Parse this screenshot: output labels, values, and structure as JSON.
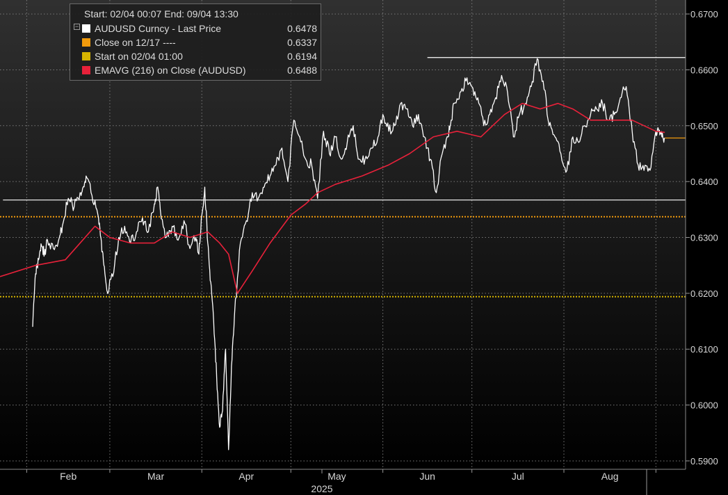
{
  "legend": {
    "header": "Start: 02/04 00:07 End: 09/04 13:30",
    "items": [
      {
        "label": "AUDUSD Curncy - Last Price",
        "value": "0.6478",
        "color": "#ffffff"
      },
      {
        "label": "Close on 12/17 ----",
        "value": "0.6337",
        "color": "#f29b0c"
      },
      {
        "label": "Start on 02/04 01:00",
        "value": "0.6194",
        "color": "#d6b400"
      },
      {
        "label": "EMAVG (216)  on Close (AUDUSD)",
        "value": "0.6488",
        "color": "#e8213a"
      }
    ]
  },
  "chart_data": {
    "type": "line",
    "xlabel": "2025",
    "x_ticks": [
      "Feb",
      "Mar",
      "Apr",
      "May",
      "Jun",
      "Jul",
      "Aug"
    ],
    "y_ticks": [
      "0.5900",
      "0.6000",
      "0.6100",
      "0.6200",
      "0.6300",
      "0.6400",
      "0.6500",
      "0.6600",
      "0.6700"
    ],
    "ylim": [
      0.5885,
      0.6725
    ],
    "grid": true,
    "legend_position": "top-left",
    "x_range": [
      "2025-01-23",
      "2025-09-11"
    ],
    "series": [
      {
        "name": "AUDUSD Curncy - Last Price",
        "color": "#ffffff",
        "x": [
          "2025-02-03",
          "2025-02-04",
          "2025-02-05",
          "2025-02-06",
          "2025-02-07",
          "2025-02-08",
          "2025-02-10",
          "2025-02-12",
          "2025-02-13",
          "2025-02-15",
          "2025-02-17",
          "2025-02-19",
          "2025-02-20",
          "2025-02-21",
          "2025-02-23",
          "2025-02-25",
          "2025-02-26",
          "2025-02-27",
          "2025-02-28",
          "2025-03-02",
          "2025-03-04",
          "2025-03-06",
          "2025-03-08",
          "2025-03-10",
          "2025-03-12",
          "2025-03-14",
          "2025-03-16",
          "2025-03-17",
          "2025-03-18",
          "2025-03-20",
          "2025-03-22",
          "2025-03-24",
          "2025-03-26",
          "2025-03-28",
          "2025-03-30",
          "2025-03-31",
          "2025-04-01",
          "2025-04-02",
          "2025-04-03",
          "2025-04-04",
          "2025-04-05",
          "2025-04-06",
          "2025-04-07",
          "2025-04-08",
          "2025-04-09",
          "2025-04-10",
          "2025-04-11",
          "2025-04-12",
          "2025-04-14",
          "2025-04-16",
          "2025-04-18",
          "2025-04-20",
          "2025-04-22",
          "2025-04-24",
          "2025-04-26",
          "2025-04-28",
          "2025-04-30",
          "2025-05-02",
          "2025-05-04",
          "2025-05-06",
          "2025-05-08",
          "2025-05-10",
          "2025-05-12",
          "2025-05-14",
          "2025-05-16",
          "2025-05-18",
          "2025-05-20",
          "2025-05-22",
          "2025-05-24",
          "2025-05-26",
          "2025-05-28",
          "2025-05-30",
          "2025-06-01",
          "2025-06-03",
          "2025-06-05",
          "2025-06-07",
          "2025-06-09",
          "2025-06-11",
          "2025-06-13",
          "2025-06-15",
          "2025-06-17",
          "2025-06-19",
          "2025-06-21",
          "2025-06-23",
          "2025-06-24",
          "2025-06-25",
          "2025-06-27",
          "2025-06-29",
          "2025-07-01",
          "2025-07-03",
          "2025-07-05",
          "2025-07-07",
          "2025-07-09",
          "2025-07-11",
          "2025-07-13",
          "2025-07-15",
          "2025-07-17",
          "2025-07-19",
          "2025-07-21",
          "2025-07-23",
          "2025-07-25",
          "2025-07-27",
          "2025-07-29",
          "2025-07-31",
          "2025-08-02",
          "2025-08-04",
          "2025-08-06",
          "2025-08-08",
          "2025-08-10",
          "2025-08-12",
          "2025-08-14",
          "2025-08-16",
          "2025-08-18",
          "2025-08-20",
          "2025-08-22",
          "2025-08-24",
          "2025-08-26",
          "2025-08-28",
          "2025-08-30",
          "2025-09-01",
          "2025-09-02",
          "2025-09-03",
          "2025-09-04"
        ],
        "y": [
          0.614,
          0.6235,
          0.626,
          0.6285,
          0.627,
          0.6295,
          0.628,
          0.63,
          0.632,
          0.637,
          0.6355,
          0.638,
          0.639,
          0.641,
          0.6375,
          0.634,
          0.63,
          0.625,
          0.6205,
          0.623,
          0.63,
          0.632,
          0.629,
          0.631,
          0.6335,
          0.631,
          0.636,
          0.639,
          0.635,
          0.63,
          0.632,
          0.6295,
          0.633,
          0.628,
          0.63,
          0.627,
          0.634,
          0.639,
          0.629,
          0.622,
          0.615,
          0.605,
          0.596,
          0.599,
          0.61,
          0.592,
          0.607,
          0.616,
          0.629,
          0.633,
          0.638,
          0.637,
          0.639,
          0.641,
          0.643,
          0.646,
          0.64,
          0.651,
          0.648,
          0.644,
          0.643,
          0.637,
          0.649,
          0.645,
          0.648,
          0.644,
          0.647,
          0.65,
          0.644,
          0.644,
          0.646,
          0.647,
          0.652,
          0.649,
          0.65,
          0.654,
          0.653,
          0.65,
          0.652,
          0.648,
          0.644,
          0.638,
          0.645,
          0.648,
          0.651,
          0.654,
          0.656,
          0.658,
          0.657,
          0.655,
          0.65,
          0.652,
          0.655,
          0.659,
          0.656,
          0.648,
          0.652,
          0.654,
          0.657,
          0.662,
          0.658,
          0.65,
          0.648,
          0.645,
          0.642,
          0.648,
          0.647,
          0.65,
          0.652,
          0.653,
          0.654,
          0.651,
          0.652,
          0.655,
          0.657,
          0.649,
          0.643,
          0.642,
          0.642,
          0.649,
          0.649,
          0.648,
          0.6478
        ]
      },
      {
        "name": "EMAVG (216)  on Close (AUDUSD)",
        "color": "#e8213a",
        "x": [
          "2025-01-23",
          "2025-02-04",
          "2025-02-14",
          "2025-02-24",
          "2025-03-01",
          "2025-03-08",
          "2025-03-16",
          "2025-03-22",
          "2025-03-28",
          "2025-04-03",
          "2025-04-07",
          "2025-04-10",
          "2025-04-13",
          "2025-04-18",
          "2025-04-24",
          "2025-05-01",
          "2025-05-06",
          "2025-05-10",
          "2025-05-16",
          "2025-05-25",
          "2025-06-03",
          "2025-06-10",
          "2025-06-18",
          "2025-06-26",
          "2025-07-04",
          "2025-07-12",
          "2025-07-18",
          "2025-07-24",
          "2025-07-30",
          "2025-08-04",
          "2025-08-10",
          "2025-08-18",
          "2025-08-24",
          "2025-08-28",
          "2025-09-01",
          "2025-09-04"
        ],
        "y": [
          0.623,
          0.625,
          0.626,
          0.632,
          0.63,
          0.629,
          0.629,
          0.631,
          0.63,
          0.631,
          0.629,
          0.627,
          0.62,
          0.624,
          0.629,
          0.634,
          0.636,
          0.638,
          0.6395,
          0.641,
          0.643,
          0.645,
          0.648,
          0.649,
          0.648,
          0.652,
          0.654,
          0.653,
          0.654,
          0.653,
          0.651,
          0.651,
          0.651,
          0.65,
          0.649,
          0.6488
        ]
      }
    ],
    "reference_lines": [
      {
        "label": "Close on 12/17 ----",
        "y": 0.6337,
        "color": "#f29b0c",
        "style": "dotted",
        "from": "2025-01-23",
        "to": "2025-09-11"
      },
      {
        "label": "Start on 02/04 01:00",
        "y": 0.6194,
        "color": "#d6b400",
        "style": "dotted",
        "from": "2025-01-23",
        "to": "2025-09-11"
      },
      {
        "label": "",
        "y": 0.6367,
        "color": "#ffffff",
        "style": "solid",
        "from": "2025-01-24",
        "to": "2025-09-11"
      },
      {
        "label": "",
        "y": 0.6622,
        "color": "#ffffff",
        "style": "solid",
        "from": "2025-06-16",
        "to": "2025-09-11"
      },
      {
        "label": "",
        "y": 0.6478,
        "color": "#f29b0c",
        "style": "solid",
        "from": "2025-09-04",
        "to": "2025-09-11"
      }
    ]
  }
}
